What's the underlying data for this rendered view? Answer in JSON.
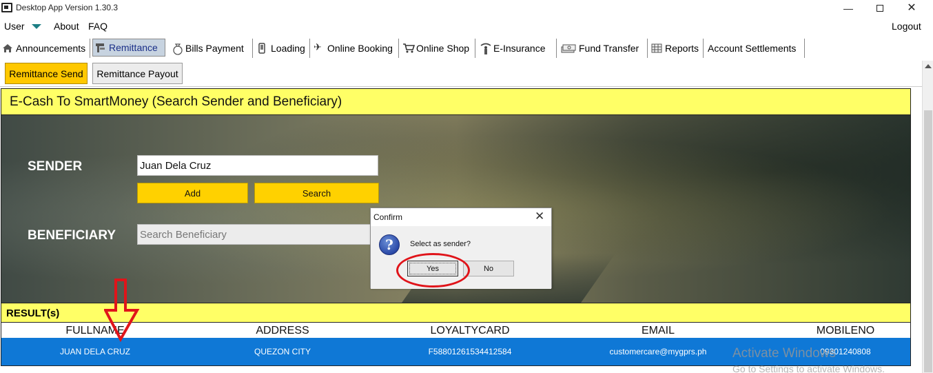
{
  "window": {
    "title": "Desktop App Version 1.30.3",
    "controls": {
      "minimize": "—",
      "close": "✕"
    }
  },
  "menu": {
    "user": "User",
    "about": "About",
    "faq": "FAQ",
    "logout": "Logout"
  },
  "tabs": [
    {
      "label": "Announcements",
      "icon": "home-icon"
    },
    {
      "label": "Remittance",
      "icon": "remittance-icon",
      "active": true
    },
    {
      "label": "Bills Payment",
      "icon": "money-bag-icon"
    },
    {
      "label": "Loading",
      "icon": "phone-icon"
    },
    {
      "label": "Online Booking",
      "icon": "airplane-icon"
    },
    {
      "label": "Online Shop",
      "icon": "cart-icon"
    },
    {
      "label": "E-Insurance",
      "icon": "insurance-icon"
    },
    {
      "label": "Fund Transfer",
      "icon": "money-stack-icon"
    },
    {
      "label": "Reports",
      "icon": "reports-icon"
    },
    {
      "label": "Account Settlements",
      "icon": ""
    }
  ],
  "subtabs": [
    {
      "label": "Remittance Send",
      "active": true
    },
    {
      "label": "Remittance Payout",
      "active": false
    }
  ],
  "panel": {
    "title": "E-Cash To SmartMoney (Search Sender and Beneficiary)",
    "sender_label": "SENDER",
    "sender_value": "Juan Dela Cruz",
    "add_label": "Add",
    "search_label": "Search",
    "beneficiary_label": "BENEFICIARY",
    "beneficiary_placeholder": "Search Beneficiary"
  },
  "results": {
    "title": "RESULT(s)",
    "columns": [
      "FULLNAME",
      "ADDRESS",
      "LOYALTYCARD",
      "EMAIL",
      "MOBILENO"
    ],
    "rows": [
      [
        "JUAN DELA CRUZ",
        "QUEZON CITY",
        "F58801261534412584",
        "customercare@mygprs.ph",
        "09301240808"
      ]
    ]
  },
  "dialog": {
    "title": "Confirm",
    "message": "Select as sender?",
    "yes": "Yes",
    "no": "No",
    "close": "✕",
    "icon": "question-icon"
  },
  "watermark": {
    "line1": "Activate Windows",
    "line2": "Go to Settings to activate Windows."
  },
  "colors": {
    "accent_yellow": "#ffd100",
    "header_yellow": "#ffff66",
    "selection_blue": "#0f78d6",
    "annotation_red": "#e0141a"
  }
}
